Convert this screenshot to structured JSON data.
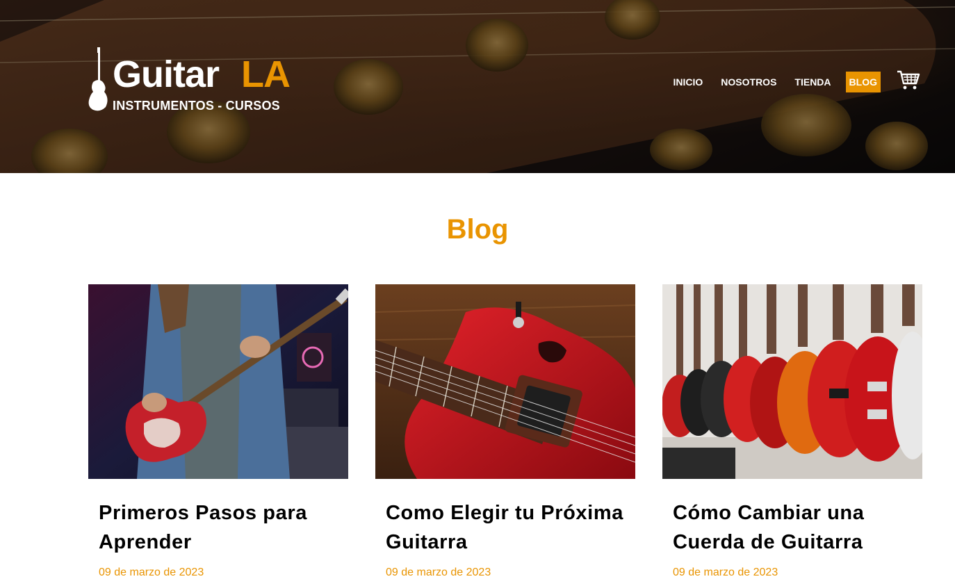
{
  "header": {
    "logo": {
      "brand_main": "Guitar",
      "brand_accent": "LA",
      "tagline": "INSTRUMENTOS - CURSOS"
    },
    "nav": [
      {
        "label": "INICIO",
        "active": false
      },
      {
        "label": "NOSOTROS",
        "active": false
      },
      {
        "label": "TIENDA",
        "active": false
      },
      {
        "label": "BLOG",
        "active": true
      }
    ],
    "cart_icon": "shopping-cart-icon"
  },
  "main": {
    "title": "Blog",
    "posts": [
      {
        "title": "Primeros Pasos para Aprender",
        "date": "09 de marzo de 2023",
        "image": "man-playing-red-electric-guitar"
      },
      {
        "title": "Como Elegir tu Próxima Guitarra",
        "date": "09 de marzo de 2023",
        "image": "red-hollow-body-guitar-closeup"
      },
      {
        "title": "Cómo Cambiar una Cuerda de Guitarra",
        "date": "09 de marzo de 2023",
        "image": "guitars-on-store-wall"
      }
    ]
  },
  "colors": {
    "accent": "#e99401",
    "text": "#000000",
    "white": "#ffffff"
  }
}
